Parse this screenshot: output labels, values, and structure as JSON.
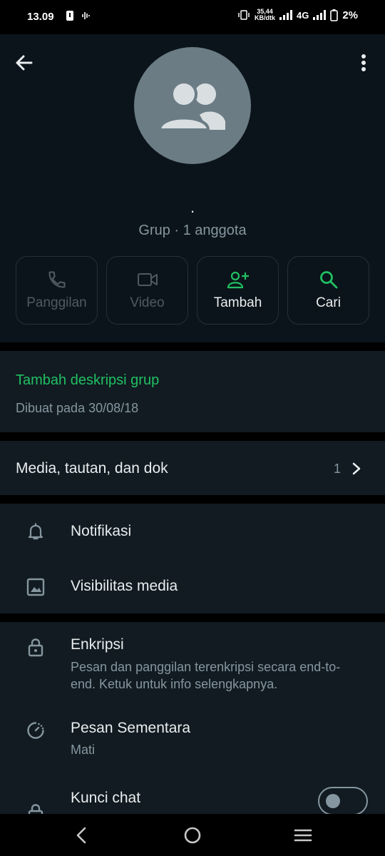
{
  "status_bar": {
    "time": "13.09",
    "speed_value": "35,44",
    "speed_unit": "KB/dtk",
    "network": "4G",
    "battery": "2%"
  },
  "header": {
    "group_name": ".",
    "subtitle": "Grup · 1 anggota"
  },
  "actions": [
    {
      "label": "Panggilan",
      "icon": "phone-icon",
      "enabled": false
    },
    {
      "label": "Video",
      "icon": "video-icon",
      "enabled": false
    },
    {
      "label": "Tambah",
      "icon": "add-person-icon",
      "enabled": true
    },
    {
      "label": "Cari",
      "icon": "search-icon",
      "enabled": true
    }
  ],
  "description": {
    "add_link": "Tambah deskripsi grup",
    "created": "Dibuat pada 30/08/18"
  },
  "media": {
    "title": "Media, tautan, dan dok",
    "count": "1"
  },
  "settings": {
    "notifications": "Notifikasi",
    "media_visibility": "Visibilitas media"
  },
  "security": {
    "encryption_title": "Enkripsi",
    "encryption_sub": "Pesan dan panggilan terenkripsi secara end-to-end. Ketuk untuk info selengkapnya.",
    "disappearing_title": "Pesan Sementara",
    "disappearing_sub": "Mati",
    "lock_title": "Kunci chat",
    "lock_on": false
  },
  "colors": {
    "accent": "#21c063",
    "background": "#0b141a",
    "section": "#111b21",
    "muted": "#8696a0"
  }
}
